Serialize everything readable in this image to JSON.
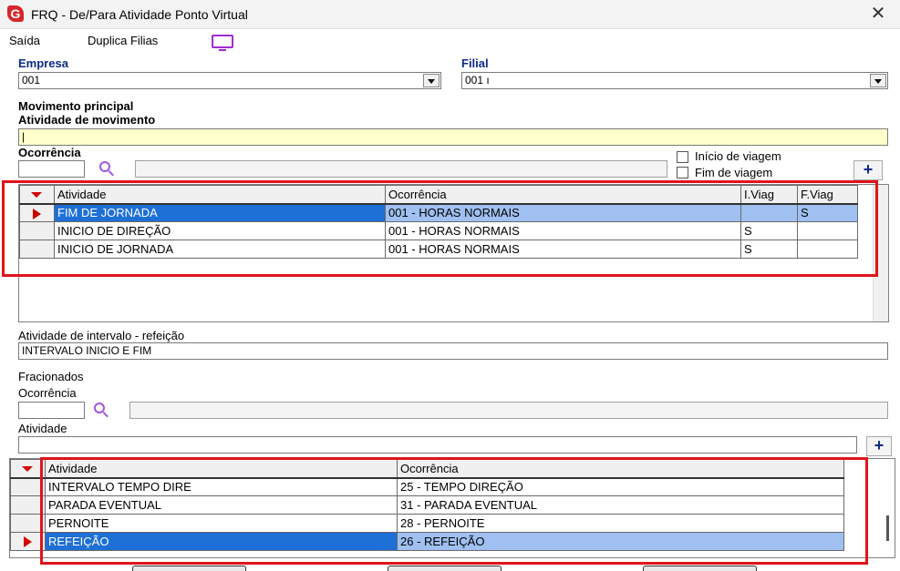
{
  "window": {
    "title": "FRQ - De/Para Atividade Ponto Virtual",
    "logo_letter": "G",
    "close_glyph": "✕"
  },
  "menu": {
    "items": [
      "Saída",
      "Duplica Filias"
    ]
  },
  "empresa": {
    "label": "Empresa",
    "value": "001"
  },
  "filial": {
    "label": "Filial",
    "value": "001 ı"
  },
  "movimento": {
    "section_label": "Movimento principal",
    "atividade_label": "Atividade de movimento",
    "atividade_value": "|",
    "ocorrencia_label": "Ocorrência",
    "ocorrencia_code": "",
    "ocorrencia_desc": "",
    "inicio_viagem_label": "Início de viagem",
    "fim_viagem_label": "Fim de viagem",
    "add_glyph": "+"
  },
  "grid1": {
    "columns": [
      "Atividade",
      "Ocorrência",
      "I.Viag",
      "F.Viag"
    ],
    "rows": [
      {
        "atividade": "FIM DE JORNADA",
        "ocorrencia": "001 - HORAS NORMAIS",
        "iviag": "",
        "fviag": "S"
      },
      {
        "atividade": "INICIO DE DIREÇÃO",
        "ocorrencia": "001 - HORAS NORMAIS",
        "iviag": "S",
        "fviag": ""
      },
      {
        "atividade": "INICIO DE JORNADA",
        "ocorrencia": "001 - HORAS NORMAIS",
        "iviag": "S",
        "fviag": ""
      }
    ]
  },
  "intervalo": {
    "label": "Atividade de intervalo - refeição",
    "value": "INTERVALO INICIO E FIM"
  },
  "fracionados": {
    "section_label": "Fracionados",
    "ocorrencia_label": "Ocorrência",
    "ocorrencia_code": "",
    "ocorrencia_desc": "",
    "atividade_label": "Atividade",
    "atividade_value": "",
    "add_glyph": "+"
  },
  "grid2": {
    "columns": [
      "Atividade",
      "Ocorrência"
    ],
    "rows": [
      {
        "atividade": "INTERVALO TEMPO DIRE",
        "ocorrencia": "25 - TEMPO DIREÇÃO"
      },
      {
        "atividade": "PARADA EVENTUAL",
        "ocorrencia": "31 - PARADA EVENTUAL"
      },
      {
        "atividade": "PERNOITE",
        "ocorrencia": "28 - PERNOITE"
      },
      {
        "atividade": "REFEIÇÃO",
        "ocorrencia": "26 - REFEIÇÃO"
      }
    ]
  },
  "colors": {
    "selection": "#1e6fd6",
    "highlight_box": "#e0141c",
    "label_blue": "#0c2a8a"
  }
}
